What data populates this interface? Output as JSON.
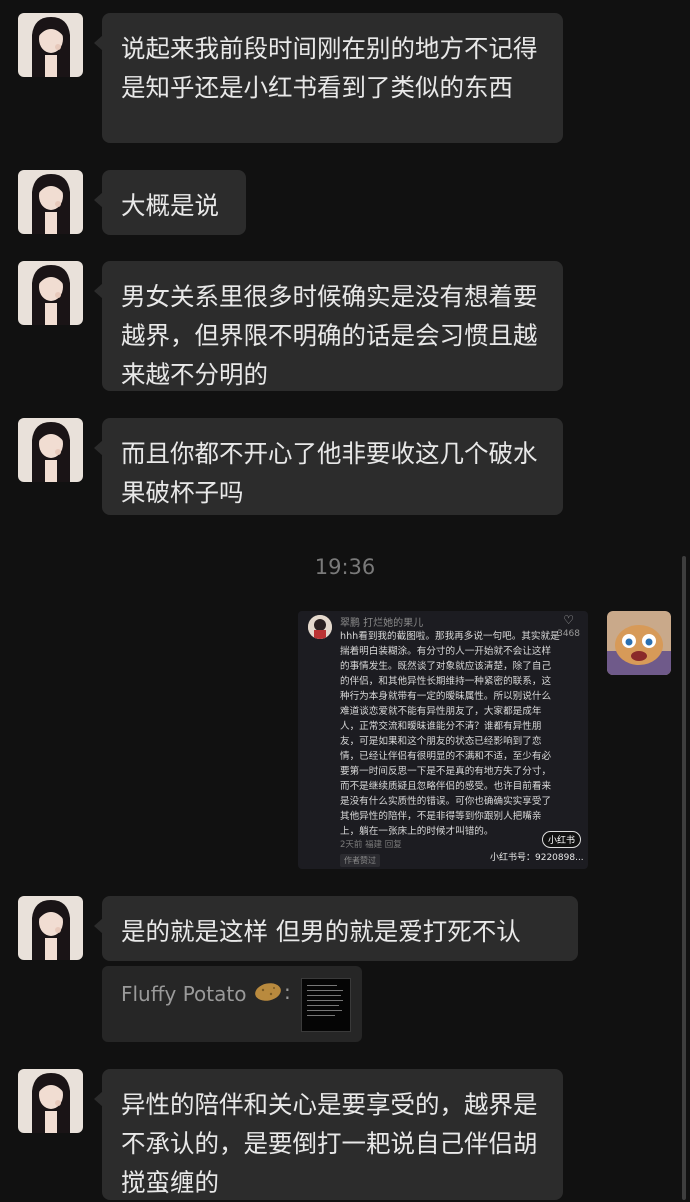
{
  "messages": [
    {
      "text": "说起来我前段时间刚在别的地方不记得是知乎还是小红书看到了类似的东西"
    },
    {
      "text": "大概是说"
    },
    {
      "text": "男女关系里很多时候确实是没有想着要越界，但界限不明确的话是会习惯且越来越不分明的"
    },
    {
      "text": "而且你都不开心了他非要收这几个破水果破杯子吗"
    },
    {
      "text": "是的就是这样  但男的就是爱打死不认"
    },
    {
      "text": "异性的陪伴和关心是要享受的，越界是不承认的，是要倒打一耙说自己伴侣胡搅蛮缠的"
    }
  ],
  "timestamp": "19:36",
  "shared_image": {
    "author": "翠鹏 打烂她的果儿",
    "likes": "3468",
    "body": "hhh看到我的截图啦。那我再多说一句吧。其实就是揣着明白装糊涂。有分寸的人一开始就不会让这样的事情发生。既然谈了对象就应该清楚，除了自己的伴侣，和其他异性长期维持一种紧密的联系，这种行为本身就带有一定的暧昧属性。所以别说什么难道谈恋爱就不能有异性朋友了，大家都是成年人，正常交流和暧昧谁能分不清？谁都有异性朋友，可是如果和这个朋友的状态已经影响到了恋情，已经让伴侣有很明显的不满和不适，至少有必要第一时间反思一下是不是真的有地方失了分寸，而不是继续质疑且忽略伴侣的感受。也许目前看来是没有什么实质性的错误。可你也确确实实享受了其他异性的陪伴，不是非得等到你跟别人把嘴亲上，躺在一张床上的时候才叫错的。",
    "meta": "2天前 福建 回复",
    "tag": "作者赞过",
    "badge": "小红书",
    "watermark": "小红书号：9220898..."
  },
  "quote": {
    "sender": "Fluffy Potato"
  },
  "colors": {
    "background": "#111111",
    "bubble": "#2c2c2c",
    "text": "#e8e8e8",
    "timestamp": "#7a7a7a"
  }
}
